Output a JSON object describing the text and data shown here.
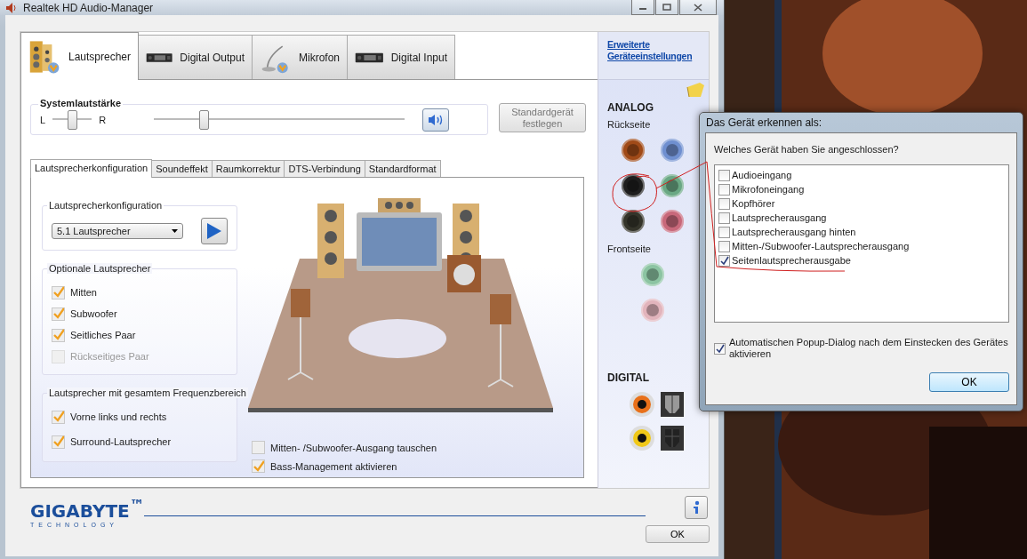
{
  "window": {
    "title": "Realtek HD Audio-Manager"
  },
  "device_tabs": [
    {
      "label": "Lautsprecher",
      "selected": true,
      "kind": "speaker"
    },
    {
      "label": "Digital Output",
      "selected": false,
      "kind": "device"
    },
    {
      "label": "Mikrofon",
      "selected": false,
      "kind": "microphone"
    },
    {
      "label": "Digital Input",
      "selected": false,
      "kind": "device"
    }
  ],
  "system_volume": {
    "label": "Systemlautstärke",
    "left": "L",
    "right": "R",
    "balance": {
      "level": 0.5
    },
    "volume": {
      "level": 0.2
    },
    "default_button": "Standardgerät festlegen"
  },
  "sub_tabs": [
    {
      "label": "Lautsprecherkonfiguration",
      "selected": true
    },
    {
      "label": "Soundeffekt",
      "selected": false
    },
    {
      "label": "Raumkorrektur",
      "selected": false
    },
    {
      "label": "DTS-Verbindung",
      "selected": false
    },
    {
      "label": "Standardformat",
      "selected": false
    }
  ],
  "speaker_config": {
    "label": "Lautsprecherkonfiguration",
    "value": "5.1 Lautsprecher"
  },
  "optional_speakers": {
    "title": "Optionale Lautsprecher",
    "items": [
      {
        "label": "Mitten",
        "checked": true,
        "disabled": false
      },
      {
        "label": "Subwoofer",
        "checked": true,
        "disabled": false
      },
      {
        "label": "Seitliches Paar",
        "checked": true,
        "disabled": false
      },
      {
        "label": "Rückseitiges Paar",
        "checked": false,
        "disabled": true
      }
    ]
  },
  "fullrange_speakers": {
    "title": "Lautsprecher mit gesamtem Frequenzbereich",
    "items": [
      {
        "label": "Vorne links und rechts",
        "checked": true
      },
      {
        "label": "Surround-Lautsprecher",
        "checked": true
      }
    ]
  },
  "options": [
    {
      "label": "Mitten- /Subwoofer-Ausgang tauschen",
      "checked": false
    },
    {
      "label": "Bass-Management aktivieren",
      "checked": true
    }
  ],
  "side_panel": {
    "link": "Erweiterte Geräteeinstellungen",
    "analog_title": "ANALOG",
    "rear_label": "Rückseite",
    "rear_jacks": [
      {
        "color": "#a04a18"
      },
      {
        "color": "#6f8fd0"
      },
      {
        "color": "#1e1e1e"
      },
      {
        "color": "#6aa884"
      },
      {
        "color": "#34342a"
      },
      {
        "color": "#c8687a"
      }
    ],
    "front_label": "Frontseite",
    "front_jacks": [
      {
        "color": "#8cc4a2"
      },
      {
        "color": "#e2b4bc"
      }
    ],
    "digital_title": "DIGITAL"
  },
  "footer": {
    "logo": "GIGABYTE$^{™}$",
    "logo_sub": "TECHNOLOGY",
    "ok": "OK"
  },
  "dialog": {
    "title": "Das Gerät erkennen als:",
    "question": "Welches Gerät haben Sie angeschlossen?",
    "options": [
      {
        "label": "Audioeingang",
        "checked": false
      },
      {
        "label": "Mikrofoneingang",
        "checked": false
      },
      {
        "label": "Kopfhörer",
        "checked": false
      },
      {
        "label": "Lautsprecherausgang",
        "checked": false
      },
      {
        "label": "Lautsprecherausgang hinten",
        "checked": false
      },
      {
        "label": "Mitten-/Subwoofer-Lautsprecherausgang",
        "checked": false
      },
      {
        "label": "Seitenlautsprecherausgabe",
        "checked": true
      }
    ],
    "auto_popup": {
      "label": "Automatischen Popup-Dialog nach dem Einstecken des Gerätes aktivieren",
      "checked": true
    },
    "ok": "OK"
  }
}
